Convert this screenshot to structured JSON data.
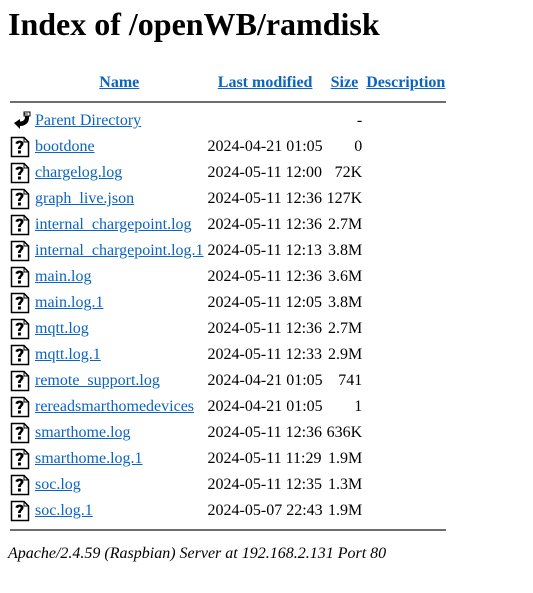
{
  "page": {
    "title": "Index of /openWB/ramdisk"
  },
  "table": {
    "headers": {
      "name": "Name",
      "last_modified": "Last modified",
      "size": "Size",
      "description": "Description"
    },
    "parent": {
      "icon": "back-arrow-icon",
      "label": "Parent Directory",
      "size": "-"
    },
    "rows": [
      {
        "icon": "unknown-file-icon",
        "name": "bootdone",
        "date": "2024-04-21 01:05",
        "size": "0"
      },
      {
        "icon": "unknown-file-icon",
        "name": "chargelog.log",
        "date": "2024-05-11 12:00",
        "size": "72K"
      },
      {
        "icon": "unknown-file-icon",
        "name": "graph_live.json",
        "date": "2024-05-11 12:36",
        "size": "127K"
      },
      {
        "icon": "unknown-file-icon",
        "name": "internal_chargepoint.log",
        "date": "2024-05-11 12:36",
        "size": "2.7M"
      },
      {
        "icon": "unknown-file-icon",
        "name": "internal_chargepoint.log.1",
        "date": "2024-05-11 12:13",
        "size": "3.8M"
      },
      {
        "icon": "unknown-file-icon",
        "name": "main.log",
        "date": "2024-05-11 12:36",
        "size": "3.6M"
      },
      {
        "icon": "unknown-file-icon",
        "name": "main.log.1",
        "date": "2024-05-11 12:05",
        "size": "3.8M"
      },
      {
        "icon": "unknown-file-icon",
        "name": "mqtt.log",
        "date": "2024-05-11 12:36",
        "size": "2.7M"
      },
      {
        "icon": "unknown-file-icon",
        "name": "mqtt.log.1",
        "date": "2024-05-11 12:33",
        "size": "2.9M"
      },
      {
        "icon": "unknown-file-icon",
        "name": "remote_support.log",
        "date": "2024-04-21 01:05",
        "size": "741"
      },
      {
        "icon": "unknown-file-icon",
        "name": "rereadsmarthomedevices",
        "date": "2024-04-21 01:05",
        "size": "1"
      },
      {
        "icon": "unknown-file-icon",
        "name": "smarthome.log",
        "date": "2024-05-11 12:36",
        "size": "636K"
      },
      {
        "icon": "unknown-file-icon",
        "name": "smarthome.log.1",
        "date": "2024-05-11 11:29",
        "size": "1.9M"
      },
      {
        "icon": "unknown-file-icon",
        "name": "soc.log",
        "date": "2024-05-11 12:35",
        "size": "1.3M"
      },
      {
        "icon": "unknown-file-icon",
        "name": "soc.log.1",
        "date": "2024-05-07 22:43",
        "size": "1.9M"
      }
    ]
  },
  "footer": {
    "server_signature": "Apache/2.4.59 (Raspbian) Server at 192.168.2.131 Port 80"
  },
  "colors": {
    "link": "#0b64c0",
    "rule": "#6e6e6e"
  }
}
